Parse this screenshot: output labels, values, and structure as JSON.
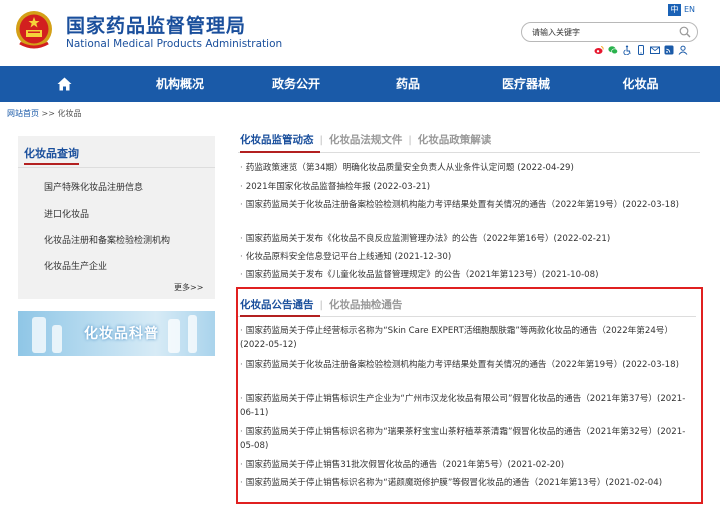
{
  "header": {
    "title_cn": "国家药品监督管理局",
    "title_en": "National Medical Products Administration",
    "lang_cn": "中",
    "lang_en": "EN",
    "search_placeholder": "请输入关键字"
  },
  "nav": {
    "items": [
      "机构概况",
      "政务公开",
      "药品",
      "医疗器械",
      "化妆品"
    ]
  },
  "breadcrumb": {
    "home": "网站首页",
    "separator": ">>",
    "current": "化妆品"
  },
  "sidebar": {
    "title": "化妆品查询",
    "items": [
      "国产特殊化妆品注册信息",
      "进口化妆品",
      "化妆品注册和备案检验检测机构",
      "化妆品生产企业"
    ],
    "more": "更多>>",
    "banner_text": "化妆品科普"
  },
  "section1": {
    "tabs": [
      "化妆品监管动态",
      "化妆品法规文件",
      "化妆品政策解读"
    ],
    "items": [
      "药监政策速览（第34期）明确化妆品质量安全负责人从业条件认定问题 (2022-04-29)",
      "2021年国家化妆品监督抽检年报 (2022-03-21)",
      "国家药监局关于化妆品注册备案检验检测机构能力考评结果处置有关情况的通告（2022年第19号）(2022-03-18)",
      "国家药监局关于发布《化妆品不良反应监测管理办法》的公告（2022年第16号）(2022-02-21)",
      "化妆品原料安全信息登记平台上线通知 (2021-12-30)",
      "国家药监局关于发布《儿童化妆品监督管理规定》的公告（2021年第123号）(2021-10-08)"
    ]
  },
  "section2": {
    "tabs": [
      "化妆品公告通告",
      "化妆品抽检通告"
    ],
    "items": [
      "国家药监局关于停止经营标示名称为“Skin Care EXPERT活细胞靓肤霜”等两款化妆品的通告（2022年第24号）(2022-05-12)",
      "国家药监局关于化妆品注册备案检验检测机构能力考评结果处置有关情况的通告（2022年第19号）(2022-03-18)",
      "国家药监局关于停止销售标识生产企业为“广州市汉龙化妆品有限公司”假冒化妆品的通告（2021年第37号）(2021-06-11)",
      "国家药监局关于停止销售标识名称为“瑞果茶籽宝宝山茶籽植萃茶清霜”假冒化妆品的通告（2021年第32号）(2021-05-08)",
      "国家药监局关于停止销售31批次假冒化妆品的通告（2021年第5号）(2021-02-20)",
      "国家药监局关于停止销售标识名称为“诺颜魔斑修护膜”等假冒化妆品的通告（2021年第13号）(2021-02-04)"
    ]
  },
  "colors": {
    "brand_blue": "#1a5aa8",
    "title_blue": "#1a4f9c",
    "highlight_red": "#e02020",
    "accent_red": "#b32020"
  },
  "icons": [
    "national-emblem-icon",
    "search-icon",
    "weibo-icon",
    "wechat-icon",
    "accessibility-icon",
    "mobile-icon",
    "mail-icon",
    "rss-icon",
    "user-icon",
    "home-icon"
  ]
}
